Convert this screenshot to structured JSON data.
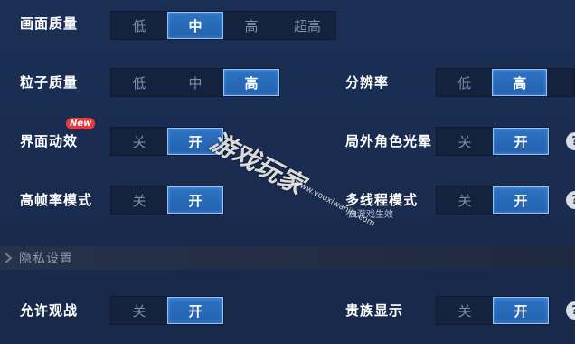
{
  "settings": {
    "graphics_quality": {
      "label": "画面质量",
      "options": [
        "低",
        "中",
        "高",
        "超高"
      ],
      "selected": "中"
    },
    "particle_quality": {
      "label": "粒子质量",
      "options": [
        "低",
        "中",
        "高"
      ],
      "selected": "高"
    },
    "resolution": {
      "label": "分辨率",
      "options": [
        "低",
        "高"
      ],
      "selected": "高"
    },
    "ui_effects": {
      "label": "界面动效",
      "badge": "New",
      "options": [
        "关",
        "开"
      ],
      "selected": "开"
    },
    "outside_halo": {
      "label": "局外角色光晕",
      "options": [
        "关",
        "开"
      ],
      "selected": "开"
    },
    "high_fps": {
      "label": "高帧率模式",
      "options": [
        "关",
        "开"
      ],
      "selected": "开"
    },
    "multithread": {
      "label": "多线程模式",
      "hint": "启游戏生效",
      "options": [
        "关",
        "开"
      ],
      "selected": "开"
    }
  },
  "privacy": {
    "section_title": "隐私设置",
    "allow_spectate": {
      "label": "允许观战",
      "options": [
        "关",
        "开"
      ],
      "selected": "开"
    },
    "noble_display": {
      "label": "贵族显示",
      "options": [
        "关",
        "开"
      ],
      "selected": "开"
    }
  },
  "help_glyph": "?",
  "watermark": {
    "text": "游戏玩家",
    "sub": "www.youxiwanjia.com"
  },
  "colors": {
    "selected_fill": "#2361ad",
    "selected_border": "#8fc3ff",
    "background": "#1a2c50"
  }
}
